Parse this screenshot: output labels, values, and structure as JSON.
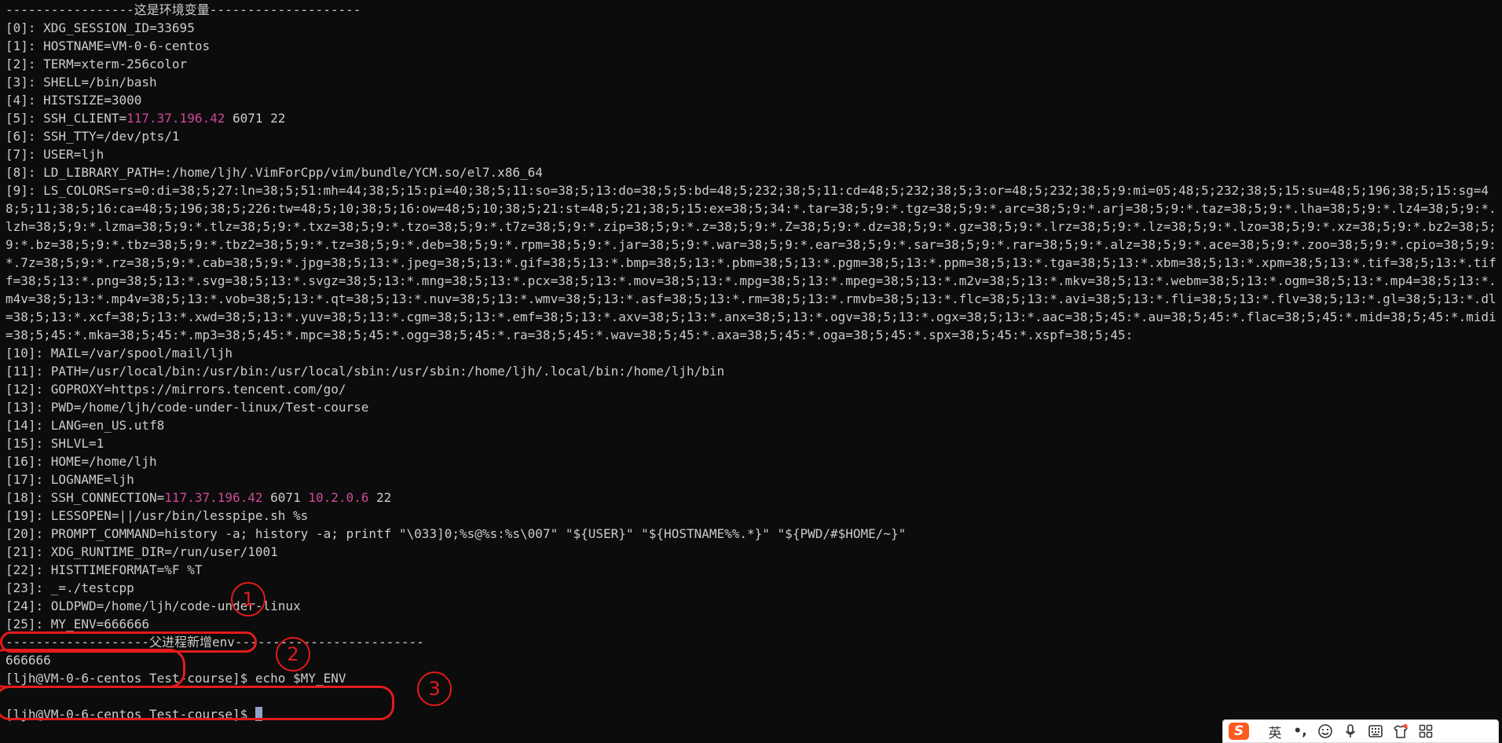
{
  "terminal": {
    "lines": [
      "-----------------这是环境变量--------------------",
      "[0]: XDG_SESSION_ID=33695",
      "[1]: HOSTNAME=VM-0-6-centos",
      "[2]: TERM=xterm-256color",
      "[3]: SHELL=/bin/bash",
      "[4]: HISTSIZE=3000"
    ],
    "ssh_client": {
      "prefix": "[5]: SSH_CLIENT=",
      "ip": "117.37.196.42",
      "suffix": " 6071 22"
    },
    "lines2": [
      "[6]: SSH_TTY=/dev/pts/1",
      "[7]: USER=ljh",
      "[8]: LD_LIBRARY_PATH=:/home/ljh/.VimForCpp/vim/bundle/YCM.so/el7.x86_64"
    ],
    "ls_colors": "[9]: LS_COLORS=rs=0:di=38;5;27:ln=38;5;51:mh=44;38;5;15:pi=40;38;5;11:so=38;5;13:do=38;5;5:bd=48;5;232;38;5;11:cd=48;5;232;38;5;3:or=48;5;232;38;5;9:mi=05;48;5;232;38;5;15:su=48;5;196;38;5;15:sg=48;5;11;38;5;16:ca=48;5;196;38;5;226:tw=48;5;10;38;5;16:ow=48;5;10;38;5;21:st=48;5;21;38;5;15:ex=38;5;34:*.tar=38;5;9:*.tgz=38;5;9:*.arc=38;5;9:*.arj=38;5;9:*.taz=38;5;9:*.lha=38;5;9:*.lz4=38;5;9:*.lzh=38;5;9:*.lzma=38;5;9:*.tlz=38;5;9:*.txz=38;5;9:*.tzo=38;5;9:*.t7z=38;5;9:*.zip=38;5;9:*.z=38;5;9:*.Z=38;5;9:*.dz=38;5;9:*.gz=38;5;9:*.lrz=38;5;9:*.lz=38;5;9:*.lzo=38;5;9:*.xz=38;5;9:*.bz2=38;5;9:*.bz=38;5;9:*.tbz=38;5;9:*.tbz2=38;5;9:*.tz=38;5;9:*.deb=38;5;9:*.rpm=38;5;9:*.jar=38;5;9:*.war=38;5;9:*.ear=38;5;9:*.sar=38;5;9:*.rar=38;5;9:*.alz=38;5;9:*.ace=38;5;9:*.zoo=38;5;9:*.cpio=38;5;9:*.7z=38;5;9:*.rz=38;5;9:*.cab=38;5;9:*.jpg=38;5;13:*.jpeg=38;5;13:*.gif=38;5;13:*.bmp=38;5;13:*.pbm=38;5;13:*.pgm=38;5;13:*.ppm=38;5;13:*.tga=38;5;13:*.xbm=38;5;13:*.xpm=38;5;13:*.tif=38;5;13:*.tiff=38;5;13:*.png=38;5;13:*.svg=38;5;13:*.svgz=38;5;13:*.mng=38;5;13:*.pcx=38;5;13:*.mov=38;5;13:*.mpg=38;5;13:*.mpeg=38;5;13:*.m2v=38;5;13:*.mkv=38;5;13:*.webm=38;5;13:*.ogm=38;5;13:*.mp4=38;5;13:*.m4v=38;5;13:*.mp4v=38;5;13:*.vob=38;5;13:*.qt=38;5;13:*.nuv=38;5;13:*.wmv=38;5;13:*.asf=38;5;13:*.rm=38;5;13:*.rmvb=38;5;13:*.flc=38;5;13:*.avi=38;5;13:*.fli=38;5;13:*.flv=38;5;13:*.gl=38;5;13:*.dl=38;5;13:*.xcf=38;5;13:*.xwd=38;5;13:*.yuv=38;5;13:*.cgm=38;5;13:*.emf=38;5;13:*.axv=38;5;13:*.anx=38;5;13:*.ogv=38;5;13:*.ogx=38;5;13:*.aac=38;5;45:*.au=38;5;45:*.flac=38;5;45:*.mid=38;5;45:*.midi=38;5;45:*.mka=38;5;45:*.mp3=38;5;45:*.mpc=38;5;45:*.ogg=38;5;45:*.ra=38;5;45:*.wav=38;5;45:*.axa=38;5;45:*.oga=38;5;45:*.spx=38;5;45:*.xspf=38;5;45:",
    "lines3": [
      "[10]: MAIL=/var/spool/mail/ljh",
      "[11]: PATH=/usr/local/bin:/usr/bin:/usr/local/sbin:/usr/sbin:/home/ljh/.local/bin:/home/ljh/bin",
      "[12]: GOPROXY=https://mirrors.tencent.com/go/",
      "[13]: PWD=/home/ljh/code-under-linux/Test-course",
      "[14]: LANG=en_US.utf8",
      "[15]: SHLVL=1",
      "[16]: HOME=/home/ljh",
      "[17]: LOGNAME=ljh"
    ],
    "ssh_connection": {
      "prefix": "[18]: SSH_CONNECTION=",
      "ip1": "117.37.196.42",
      "mid": " 6071 ",
      "ip2": "10.2.0.6",
      "suffix": " 22"
    },
    "lines4": [
      "[19]: LESSOPEN=||/usr/bin/lesspipe.sh %s",
      "[20]: PROMPT_COMMAND=history -a; history -a; printf \"\\033]0;%s@%s:%s\\007\" \"${USER}\" \"${HOSTNAME%%.*}\" \"${PWD/#$HOME/~}\"",
      "[21]: XDG_RUNTIME_DIR=/run/user/1001",
      "[22]: HISTTIMEFORMAT=%F %T",
      "[23]: _=./testcpp",
      "[24]: OLDPWD=/home/ljh/code-under-linux",
      "[25]: MY_ENV=666666",
      "-------------------父进程新增env-------------------------",
      "666666",
      "[ljh@VM-0-6-centos Test-course]$ echo $MY_ENV",
      ""
    ],
    "prompt": "[ljh@VM-0-6-centos Test-course]$ "
  },
  "annotations": {
    "labels": [
      "1",
      "2",
      "3"
    ],
    "color": "#e31b1b"
  },
  "ime_toolbar": {
    "logo": "S",
    "lang_label": "英",
    "punct": "•,",
    "icons": [
      "emoji-icon",
      "microphone-icon",
      "keyboard-icon",
      "skin-icon",
      "grid-icon"
    ]
  },
  "colors": {
    "background": "#0c0c0c",
    "text": "#cccccc",
    "ip_highlight": "#d0489a",
    "cursor": "#8fa2c7"
  }
}
